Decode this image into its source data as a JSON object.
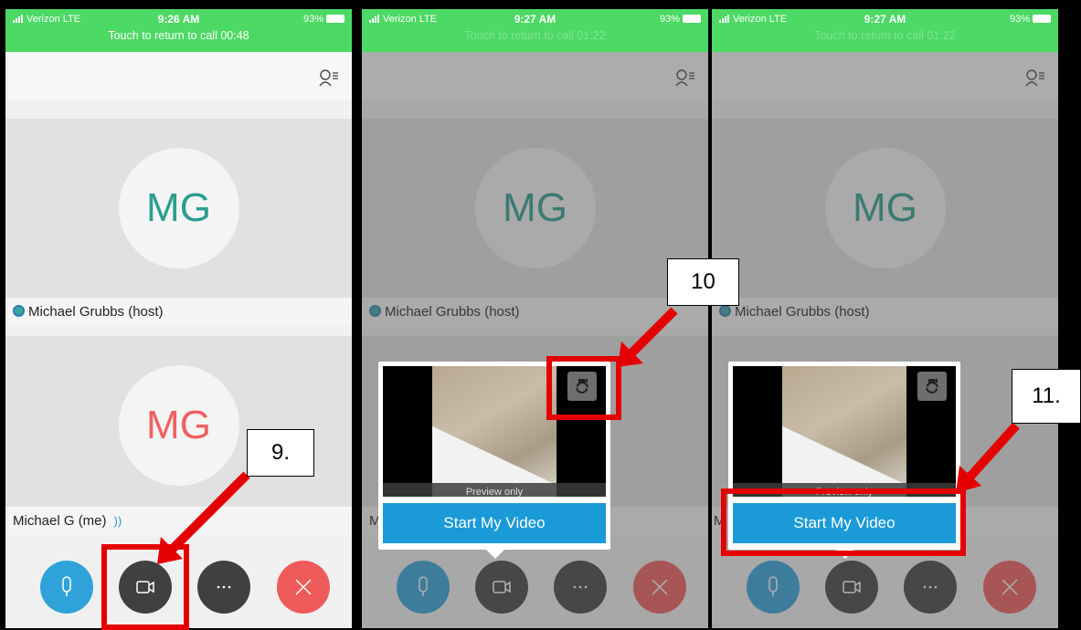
{
  "panels": [
    {
      "status": {
        "carrier": "Verizon  LTE",
        "time": "9:26 AM",
        "battery": "93%",
        "call_banner": "Touch to return to call 00:48"
      },
      "host": {
        "initials": "MG",
        "name": "Michael Grubbs (host)"
      },
      "self": {
        "initials": "MG",
        "name": "Michael G (me)"
      }
    },
    {
      "status": {
        "carrier": "Verizon  LTE",
        "time": "9:27 AM",
        "battery": "93%",
        "call_banner": "Touch to return to call 01:22"
      },
      "host": {
        "initials": "MG",
        "name": "Michael Grubbs (host)"
      },
      "self": {
        "name": "Mi"
      },
      "popup": {
        "preview_label": "Preview only",
        "start_button": "Start My Video"
      }
    },
    {
      "status": {
        "carrier": "Verizon  LTE",
        "time": "9:27 AM",
        "battery": "93%",
        "call_banner": "Touch to return to call 01:22"
      },
      "host": {
        "initials": "MG",
        "name": "Michael Grubbs (host)"
      },
      "self": {
        "name": "M"
      },
      "popup": {
        "preview_label": "Preview only",
        "start_button": "Start My Video"
      }
    }
  ],
  "callouts": {
    "step9": "9.",
    "step10": "10",
    "step11": "11."
  },
  "colors": {
    "status_green": "#4cd964",
    "avatar_teal": "#2a9d8f",
    "avatar_red": "#f06060",
    "accent_blue": "#1a9ad6",
    "annotation_red": "#e40000"
  },
  "icons": [
    "people-list-icon",
    "microphone-icon",
    "video-camera-icon",
    "more-icon",
    "end-call-icon",
    "switch-camera-icon"
  ]
}
